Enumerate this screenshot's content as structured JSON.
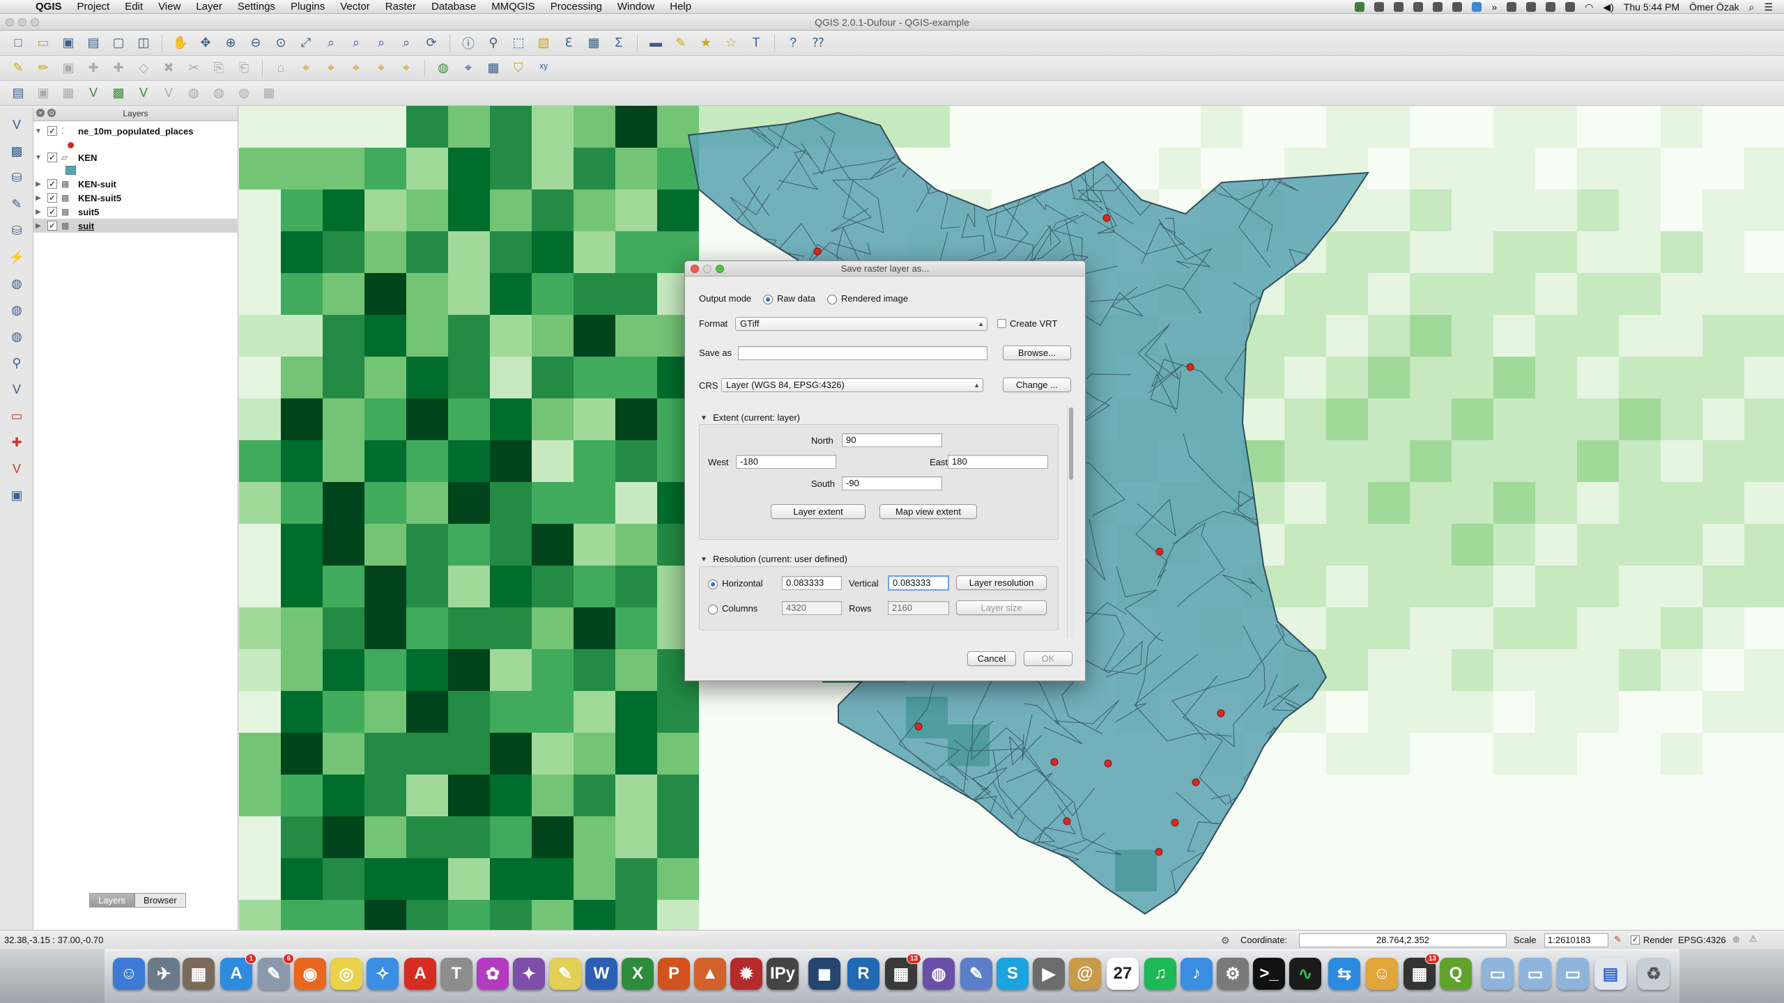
{
  "menubar": {
    "app_name": "QGIS",
    "items": [
      "Project",
      "Edit",
      "View",
      "Layer",
      "Settings",
      "Plugins",
      "Vector",
      "Raster",
      "Database",
      "MMQGIS",
      "Processing",
      "Window",
      "Help"
    ],
    "clock": "Thu 5:44 PM",
    "user": "Ömer Özak"
  },
  "window": {
    "title": "QGIS 2.0.1-Dufour - QGIS-example"
  },
  "layers_panel": {
    "title": "Layers",
    "layers": [
      {
        "name": "ne_10m_populated_places",
        "checked": true,
        "expanded": true,
        "selected": false
      },
      {
        "name": "KEN",
        "checked": true,
        "expanded": true,
        "selected": false
      },
      {
        "name": "KEN-suit",
        "checked": true,
        "expanded": false,
        "selected": false
      },
      {
        "name": "KEN-suit5",
        "checked": true,
        "expanded": false,
        "selected": false
      },
      {
        "name": "suit5",
        "checked": true,
        "expanded": false,
        "selected": false
      },
      {
        "name": "suit",
        "checked": true,
        "expanded": false,
        "selected": true
      }
    ],
    "tabs": [
      "Layers",
      "Browser"
    ],
    "active_tab": "Layers"
  },
  "dialog": {
    "title": "Save raster layer as...",
    "output_mode_label": "Output mode",
    "output_modes": [
      "Raw data",
      "Rendered image"
    ],
    "output_mode_selected": "Raw data",
    "format_label": "Format",
    "format_value": "GTiff",
    "create_vrt_label": "Create VRT",
    "create_vrt_checked": false,
    "save_as_label": "Save as",
    "save_as_value": "",
    "browse_label": "Browse...",
    "crs_label": "CRS",
    "crs_value": "Layer (WGS 84, EPSG:4326)",
    "change_label": "Change ...",
    "extent_header": "Extent (current: layer)",
    "north_label": "North",
    "north_value": "90",
    "west_label": "West",
    "west_value": "-180",
    "east_label": "East",
    "east_value": "180",
    "south_label": "South",
    "south_value": "-90",
    "layer_extent_label": "Layer extent",
    "map_view_extent_label": "Map view extent",
    "resolution_header": "Resolution (current: user defined)",
    "horizontal_label": "Horizontal",
    "horizontal_value": "0.083333",
    "vertical_label": "Vertical",
    "vertical_value": "0.083333",
    "layer_resolution_label": "Layer resolution",
    "columns_label": "Columns",
    "columns_value": "4320",
    "rows_label": "Rows",
    "rows_value": "2160",
    "layer_size_label": "Layer size",
    "resolution_mode_selected": "Horizontal",
    "cancel_label": "Cancel",
    "ok_label": "OK"
  },
  "statusbar": {
    "extents": "32.38,-3.15 : 37.00,-0.70",
    "coordinate_label": "Coordinate:",
    "coordinate_value": "28.764,2.352",
    "scale_label": "Scale",
    "scale_value": "1:2610183",
    "render_label": "Render",
    "render_checked": true,
    "crs": "EPSG:4326"
  },
  "map": {
    "raster_palette": [
      "#f7fcf5",
      "#e5f5e0",
      "#c7e9c0",
      "#a1d99b",
      "#74c476",
      "#41ab5d",
      "#238b45",
      "#006d2c",
      "#00441b"
    ],
    "polygon_fill": "#5aa2b2",
    "polygon_stroke": "#2f4f5a",
    "point_color": "#e0271f"
  },
  "dock": {
    "badges": {
      "app_store": "1",
      "preview": "6",
      "calendar": "27",
      "grid_app": "13"
    }
  }
}
